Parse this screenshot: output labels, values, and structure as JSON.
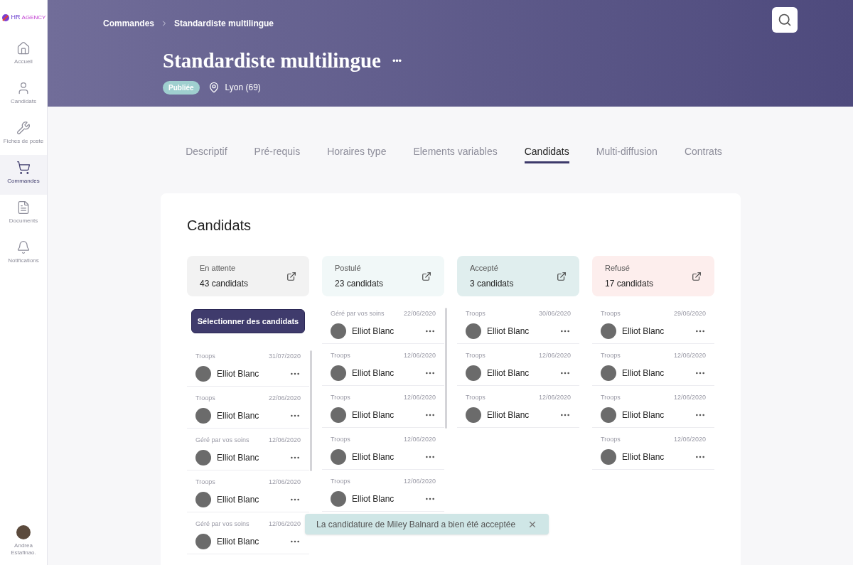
{
  "logo": {
    "text": "HR",
    "subtext": "AGENCY"
  },
  "sidebar": {
    "items": [
      {
        "label": "Accueil",
        "selected": false
      },
      {
        "label": "Candidats",
        "selected": false
      },
      {
        "label": "Fiches de poste",
        "selected": false
      },
      {
        "label": "Commandes",
        "selected": true
      },
      {
        "label": "Documents",
        "selected": false
      },
      {
        "label": "Notifications",
        "selected": false
      }
    ],
    "user": {
      "name": "Andrea Estafinao."
    }
  },
  "breadcrumb": [
    "Commandes",
    "Standardiste multilingue"
  ],
  "header": {
    "title": "Standardiste multilingue",
    "menu": "•••",
    "status": "Publiée",
    "location": "Lyon (69)"
  },
  "tabs": [
    {
      "label": "Descriptif",
      "selected": false
    },
    {
      "label": "Pré-requis",
      "selected": false
    },
    {
      "label": "Horaires type",
      "selected": false
    },
    {
      "label": "Elements variables",
      "selected": false
    },
    {
      "label": "Candidats",
      "selected": true
    },
    {
      "label": "Multi-diffusion",
      "selected": false
    },
    {
      "label": "Contrats",
      "selected": false
    }
  ],
  "panel": {
    "title": "Candidats"
  },
  "columns": [
    {
      "title": "En attente",
      "count": "43 candidats",
      "color": "#f2f2f2",
      "action": "Sélectionner des candidats",
      "cards": [
        {
          "source": "Troops",
          "date": "31/07/2020",
          "name": "Elliot Blanc"
        },
        {
          "source": "Troops",
          "date": "22/06/2020",
          "name": "Elliot Blanc"
        },
        {
          "source": "Géré par vos soins",
          "date": "12/06/2020",
          "name": "Elliot Blanc"
        },
        {
          "source": "Troops",
          "date": "12/06/2020",
          "name": "Elliot Blanc"
        },
        {
          "source": "Géré par vos soins",
          "date": "12/06/2020",
          "name": "Elliot Blanc"
        }
      ]
    },
    {
      "title": "Postulé",
      "count": "23 candidats",
      "color": "#f1f8f8",
      "cards": [
        {
          "source": "Géré par vos soins",
          "date": "22/06/2020",
          "name": "Elliot Blanc"
        },
        {
          "source": "Troops",
          "date": "12/06/2020",
          "name": "Elliot Blanc"
        },
        {
          "source": "Troops",
          "date": "12/06/2020",
          "name": "Elliot Blanc"
        },
        {
          "source": "Troops",
          "date": "12/06/2020",
          "name": "Elliot Blanc"
        },
        {
          "source": "Troops",
          "date": "12/06/2020",
          "name": "Elliot Blanc"
        }
      ]
    },
    {
      "title": "Accepté",
      "count": "3 candidats",
      "color": "#e0eeee",
      "cards": [
        {
          "source": "Troops",
          "date": "30/06/2020",
          "name": "Elliot Blanc"
        },
        {
          "source": "Troops",
          "date": "12/06/2020",
          "name": "Elliot Blanc"
        },
        {
          "source": "Troops",
          "date": "12/06/2020",
          "name": "Elliot Blanc"
        }
      ]
    },
    {
      "title": "Refusé",
      "count": "17 candidats",
      "color": "#fdeeed",
      "cards": [
        {
          "source": "Troops",
          "date": "29/06/2020",
          "name": "Elliot Blanc"
        },
        {
          "source": "Troops",
          "date": "12/06/2020",
          "name": "Elliot Blanc"
        },
        {
          "source": "Troops",
          "date": "12/06/2020",
          "name": "Elliot Blanc"
        },
        {
          "source": "Troops",
          "date": "12/06/2020",
          "name": "Elliot Blanc"
        }
      ]
    }
  ],
  "toast": {
    "message": "La candidature de Miley Balnard a bien été acceptée"
  }
}
